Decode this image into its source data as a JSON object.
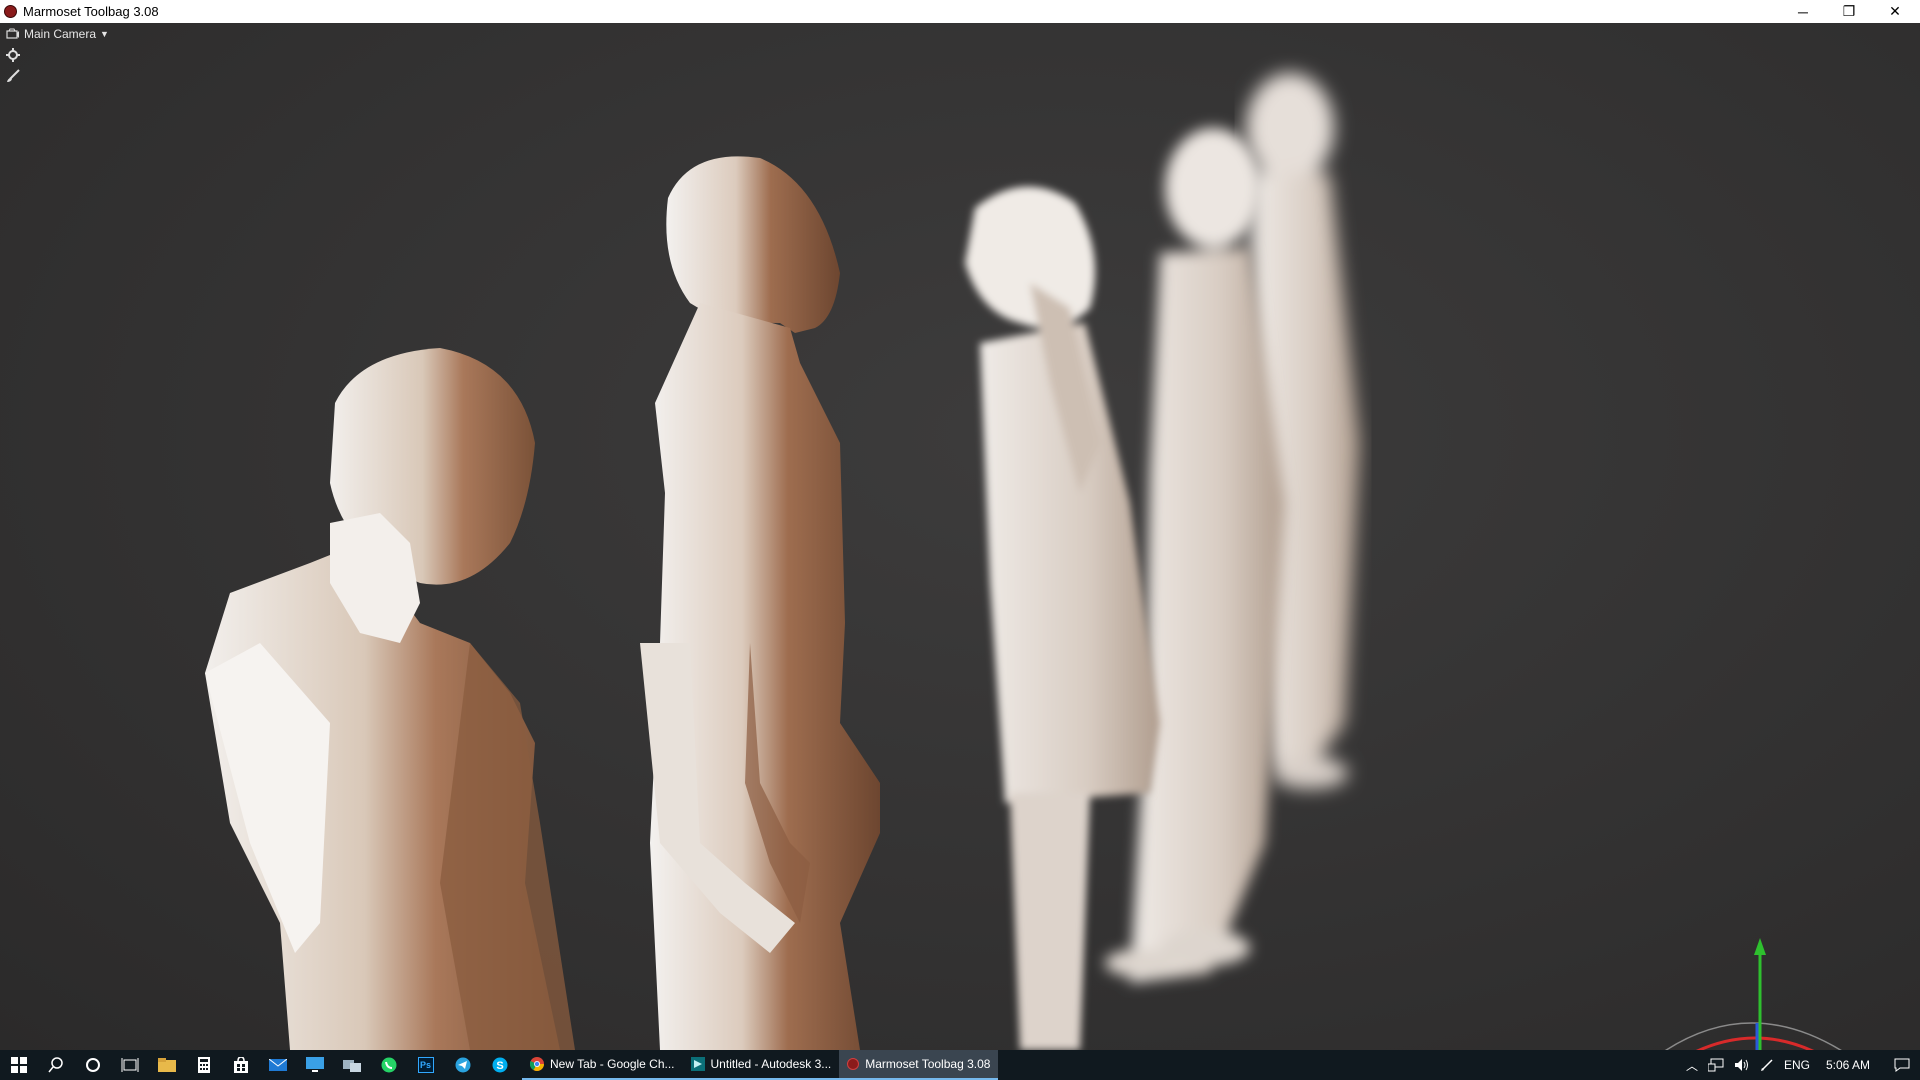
{
  "window": {
    "title": "Marmoset Toolbag 3.08",
    "minimize": "─",
    "restore": "❐",
    "close": "✕"
  },
  "viewport": {
    "camera_label": "Main Camera",
    "icons": [
      "camera-icon",
      "gear-icon",
      "brush-icon"
    ]
  },
  "taskbar": {
    "pinned_icons": [
      "windows-start-icon",
      "search-icon",
      "cortana-icon",
      "task-view-icon",
      "file-explorer-icon",
      "calculator-icon",
      "store-icon",
      "mail-icon",
      "remote-desktop-icon",
      "network-app-icon",
      "whatsapp-icon",
      "photoshop-icon",
      "telegram-icon",
      "skype-icon"
    ],
    "apps": [
      {
        "label": "New Tab - Google Ch...",
        "icon": "chrome-icon"
      },
      {
        "label": "Untitled - Autodesk 3...",
        "icon": "3dsmax-icon"
      },
      {
        "label": "Marmoset Toolbag 3.08",
        "icon": "marmoset-icon"
      }
    ],
    "tray": {
      "language": "ENG",
      "time": "5:06 AM"
    },
    "photoshop_label": "Ps"
  },
  "colors": {
    "taskbar_bg": "#10191f",
    "viewport_bg": "#353434",
    "accent": "#76b9ed"
  }
}
